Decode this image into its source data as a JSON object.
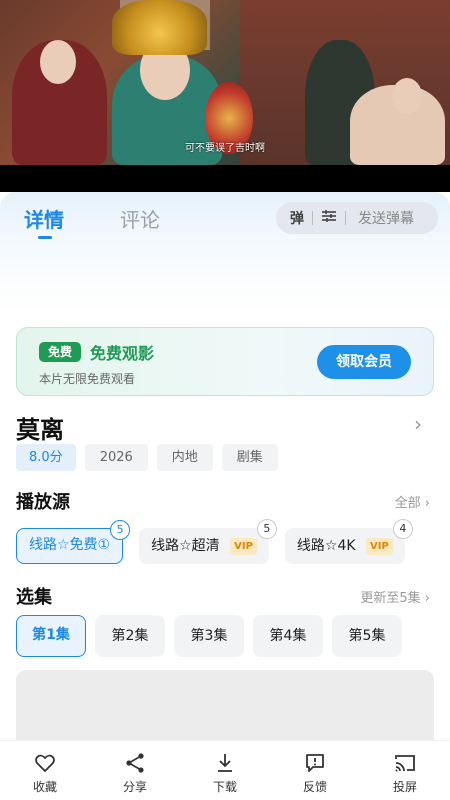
{
  "video": {
    "subtitle": "可不要误了吉时啊"
  },
  "tabs": [
    {
      "label": "详情",
      "active": true
    },
    {
      "label": "评论",
      "active": false
    }
  ],
  "danmaku": {
    "toggle_label": "弹",
    "settings_icon": "sliders-icon",
    "send_label": "发送弹幕"
  },
  "free_banner": {
    "badge": "免费",
    "title": "免费观影",
    "subtitle": "本片无限免费观看",
    "button_label": "领取会员"
  },
  "show": {
    "title": "莫离",
    "tags": [
      "8.0分",
      "2026",
      "内地",
      "剧集"
    ]
  },
  "sources_section": {
    "title": "播放源",
    "more_label": "全部",
    "items": [
      {
        "label": "线路☆免费①",
        "vip": "",
        "count": "5",
        "active": true
      },
      {
        "label": "线路☆超清",
        "vip": "VIP",
        "count": "5",
        "active": false
      },
      {
        "label": "线路☆4K",
        "vip": "VIP",
        "count": "4",
        "active": false
      }
    ]
  },
  "episodes_section": {
    "title": "选集",
    "update_label": "更新至5集",
    "items": [
      "第1集",
      "第2集",
      "第3集",
      "第4集",
      "第5集"
    ],
    "active_index": 0
  },
  "bottom_bar": [
    {
      "label": "收藏",
      "icon": "heart-icon"
    },
    {
      "label": "分享",
      "icon": "share-icon"
    },
    {
      "label": "下载",
      "icon": "download-icon"
    },
    {
      "label": "反馈",
      "icon": "feedback-icon"
    },
    {
      "label": "投屏",
      "icon": "cast-icon"
    }
  ],
  "colors": {
    "accent": "#1e88e5",
    "free_green": "#1f9b55",
    "vip_gold": "#d98a00"
  }
}
